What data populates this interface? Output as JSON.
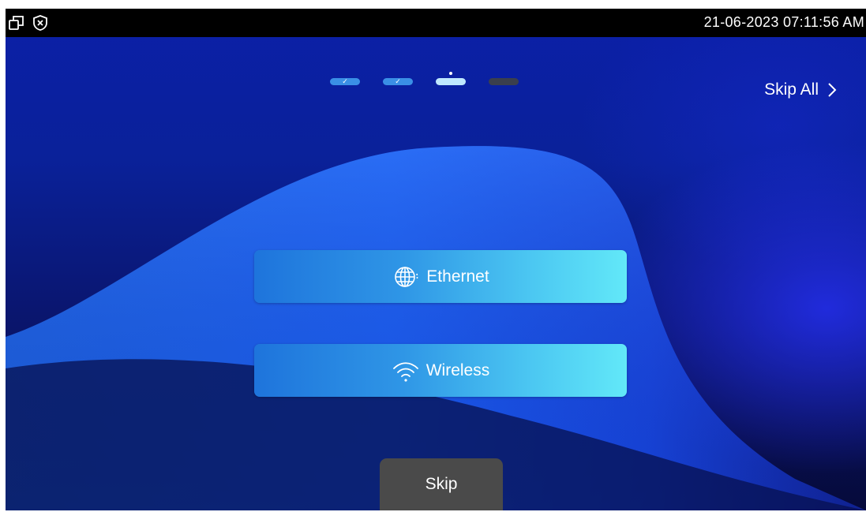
{
  "status_bar": {
    "datetime": "21-06-2023 07:11:56 AM",
    "icons": [
      "window-restore-icon",
      "shield-x-icon"
    ]
  },
  "wizard": {
    "steps": [
      {
        "state": "done",
        "mark": "✓"
      },
      {
        "state": "done",
        "mark": "✓"
      },
      {
        "state": "current",
        "mark": ""
      },
      {
        "state": "todo",
        "mark": ""
      }
    ],
    "skip_all_label": "Skip All"
  },
  "options": {
    "ethernet_label": "Ethernet",
    "wireless_label": "Wireless"
  },
  "skip_label": "Skip",
  "colors": {
    "step_done": "#3a8fe6",
    "step_current": "#bfe8ff",
    "step_todo": "#3a3f4d",
    "button_gradient_start": "#1e74dc",
    "button_gradient_end": "#62e8f8",
    "skip_button": "#4a4a4a"
  }
}
